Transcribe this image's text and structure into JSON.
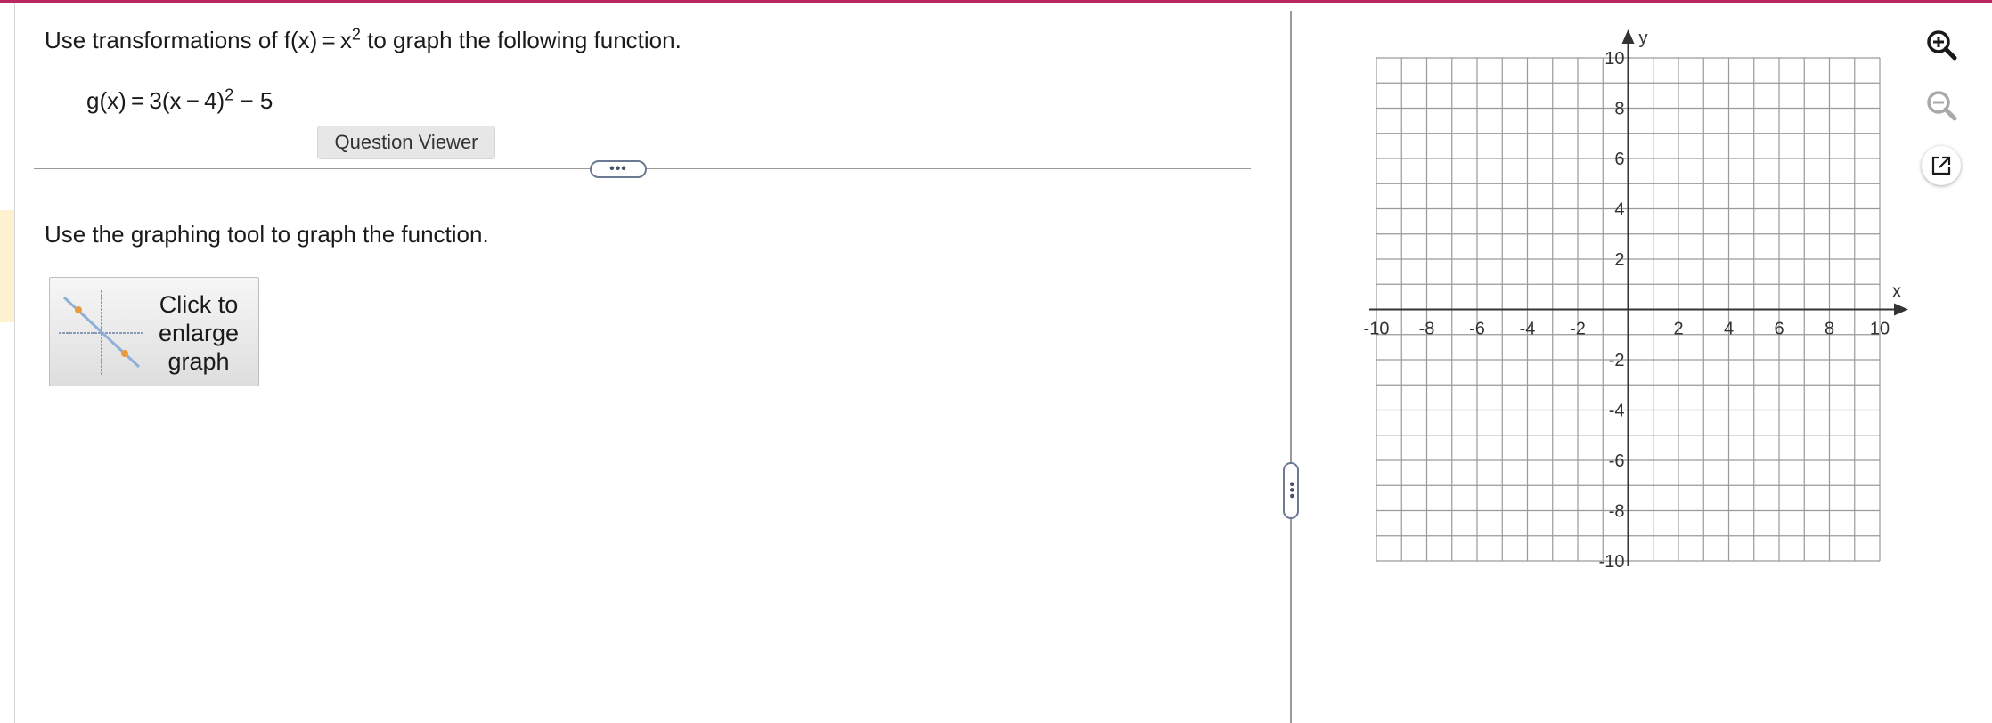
{
  "question": {
    "instruction_prefix": "Use transformations of f(x) = x",
    "instruction_exponent": "2",
    "instruction_suffix": " to graph the following function.",
    "equation_prefix": "g(x) = 3(x − 4)",
    "equation_exponent": "2",
    "equation_suffix": " − 5",
    "question_viewer_label": "Question Viewer",
    "more_handle_label": "•••"
  },
  "tool": {
    "prompt": "Use the graphing tool to graph the function.",
    "enlarge_label": "Click to\nenlarge\ngraph"
  },
  "panel_handle_label": "•••",
  "graph": {
    "x_label": "x",
    "y_label": "y",
    "xlim": [
      -10,
      10
    ],
    "ylim": [
      -10,
      10
    ],
    "minor_step": 1,
    "x_tick_labels": [
      "-10",
      "-8",
      "-6",
      "-4",
      "-2",
      "2",
      "4",
      "6",
      "8",
      "10"
    ],
    "y_tick_labels": [
      "10",
      "8",
      "6",
      "4",
      "2",
      "-2",
      "-4",
      "-6",
      "-8",
      "-10"
    ],
    "grid": true
  },
  "toolbar": {
    "zoom_in_icon": "zoom-in-icon",
    "zoom_out_icon": "zoom-out-icon",
    "popout_icon": "external-link-icon"
  },
  "colors": {
    "top_accent": "#b8285c",
    "grid_line": "#9a9a9a",
    "axis": "#333333",
    "handle_border": "#6b7a92",
    "highlight": "#fdf1cf"
  }
}
